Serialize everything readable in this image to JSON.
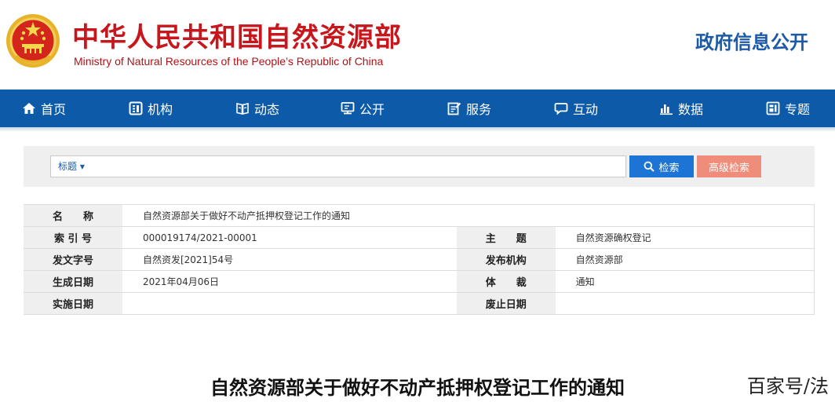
{
  "header": {
    "title_cn": "中华人民共和国自然资源部",
    "title_en": "Ministry of Natural Resources of the People’s Republic of China",
    "gov_info": "政府信息公开"
  },
  "nav": {
    "items": [
      {
        "label": "首页",
        "icon": "home-icon"
      },
      {
        "label": "机构",
        "icon": "organization-icon"
      },
      {
        "label": "动态",
        "icon": "news-icon"
      },
      {
        "label": "公开",
        "icon": "disclosure-icon"
      },
      {
        "label": "服务",
        "icon": "service-icon"
      },
      {
        "label": "互动",
        "icon": "chat-icon"
      },
      {
        "label": "数据",
        "icon": "bar-chart-icon"
      },
      {
        "label": "专题",
        "icon": "topic-icon"
      }
    ]
  },
  "search": {
    "scope": "标题 ▾",
    "placeholder": "",
    "value": "",
    "search_button": "检索",
    "advanced_button": "高级检索"
  },
  "info": {
    "name_label": "名　　称",
    "name_value": "自然资源部关于做好不动产抵押权登记工作的通知",
    "index_label": "索 引 号",
    "index_value": "000019174/2021-00001",
    "subject_label": "主　　题",
    "subject_value": "自然资源确权登记",
    "doc_no_label": "发文字号",
    "doc_no_value": "自然资发[2021]54号",
    "issuer_label": "发布机构",
    "issuer_value": "自然资源部",
    "created_label": "生成日期",
    "created_value": "2021年04月06日",
    "genre_label": "体　　裁",
    "genre_value": "通知",
    "effective_label": "实施日期",
    "effective_value": "",
    "repeal_label": "废止日期",
    "repeal_value": ""
  },
  "document": {
    "title": "自然资源部关于做好不动产抵押权登记工作的通知"
  },
  "watermark": "百家号/法",
  "colors": {
    "brand_red": "#c8161d",
    "nav_blue": "#0d5ba8",
    "search_blue": "#1d74d4",
    "advanced_salmon": "#f08c7a"
  }
}
